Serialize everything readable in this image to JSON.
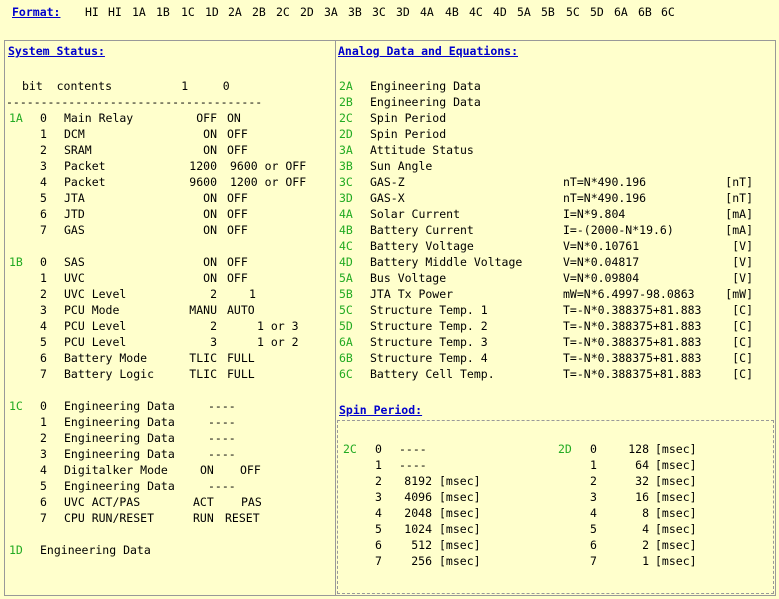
{
  "format": {
    "label": "Format:",
    "items": [
      "HI",
      "HI",
      "1A",
      "1B",
      "1C",
      "1D",
      "2A",
      "2B",
      "2C",
      "2D",
      "3A",
      "3B",
      "3C",
      "3D",
      "4A",
      "4B",
      "4C",
      "4D",
      "5A",
      "5B",
      "5C",
      "5D",
      "6A",
      "6B",
      "6C"
    ]
  },
  "system_status": {
    "title": "System Status:",
    "header": "bit  contents          1     0",
    "rule": "-------------------------------------",
    "rows": [
      {
        "byte": "1A",
        "bit": "0",
        "name": "Main Relay",
        "c1": "OFF",
        "c0": "ON"
      },
      {
        "byte": "",
        "bit": "1",
        "name": "DCM",
        "c1": "ON",
        "c0": "OFF"
      },
      {
        "byte": "",
        "bit": "2",
        "name": "SRAM",
        "c1": "ON",
        "c0": "OFF"
      },
      {
        "byte": "",
        "bit": "3",
        "name": "Packet",
        "c1": "1200",
        "c0": "9600 or OFF"
      },
      {
        "byte": "",
        "bit": "4",
        "name": "Packet",
        "c1": "9600",
        "c0": "1200 or OFF"
      },
      {
        "byte": "",
        "bit": "5",
        "name": "JTA",
        "c1": "ON",
        "c0": "OFF"
      },
      {
        "byte": "",
        "bit": "6",
        "name": "JTD",
        "c1": "ON",
        "c0": "OFF"
      },
      {
        "byte": "",
        "bit": "7",
        "name": "GAS",
        "c1": "ON",
        "c0": "OFF"
      },
      {
        "byte": "1B",
        "bit": "0",
        "name": "SAS",
        "c1": "ON",
        "c0": "OFF"
      },
      {
        "byte": "",
        "bit": "1",
        "name": "UVC",
        "c1": "ON",
        "c0": "OFF"
      },
      {
        "byte": "",
        "bit": "2",
        "name": "UVC Level",
        "c1": "2",
        "c0": "1"
      },
      {
        "byte": "",
        "bit": "3",
        "name": "PCU Mode",
        "c1": "MANU",
        "c0": "AUTO"
      },
      {
        "byte": "",
        "bit": "4",
        "name": "PCU Level",
        "c1": "2",
        "c0": "1 or 3"
      },
      {
        "byte": "",
        "bit": "5",
        "name": "PCU Level",
        "c1": "3",
        "c0": "1 or 2"
      },
      {
        "byte": "",
        "bit": "6",
        "name": "Battery Mode",
        "c1": "TLIC",
        "c0": "FULL"
      },
      {
        "byte": "",
        "bit": "7",
        "name": "Battery Logic",
        "c1": "TLIC",
        "c0": "FULL"
      },
      {
        "byte": "1C",
        "bit": "0",
        "name": "Engineering Data",
        "c1": "----",
        "c0": ""
      },
      {
        "byte": "",
        "bit": "1",
        "name": "Engineering Data",
        "c1": "----",
        "c0": ""
      },
      {
        "byte": "",
        "bit": "2",
        "name": "Engineering Data",
        "c1": "----",
        "c0": ""
      },
      {
        "byte": "",
        "bit": "3",
        "name": "Engineering Data",
        "c1": "----",
        "c0": ""
      },
      {
        "byte": "",
        "bit": "4",
        "name": "Digitalker Mode",
        "c1": "ON",
        "c0": "OFF"
      },
      {
        "byte": "",
        "bit": "5",
        "name": "Engineering Data",
        "c1": "----",
        "c0": ""
      },
      {
        "byte": "",
        "bit": "6",
        "name": "UVC ACT/PAS",
        "c1": "ACT",
        "c0": "PAS"
      },
      {
        "byte": "",
        "bit": "7",
        "name": "CPU RUN/RESET",
        "c1": "RUN",
        "c0": "RESET"
      }
    ],
    "row_1d": {
      "byte": "1D",
      "name": "Engineering Data"
    }
  },
  "analog": {
    "title": "Analog Data and Equations:",
    "rows": [
      {
        "id": "2A",
        "name": "Engineering Data",
        "eq": "",
        "unit": ""
      },
      {
        "id": "2B",
        "name": "Engineering Data",
        "eq": "",
        "unit": ""
      },
      {
        "id": "2C",
        "name": "Spin Period",
        "eq": "",
        "unit": ""
      },
      {
        "id": "2D",
        "name": "Spin Period",
        "eq": "",
        "unit": ""
      },
      {
        "id": "3A",
        "name": "Attitude Status",
        "eq": "",
        "unit": ""
      },
      {
        "id": "3B",
        "name": "Sun Angle",
        "eq": "",
        "unit": ""
      },
      {
        "id": "3C",
        "name": "GAS-Z",
        "eq": "nT=N*490.196",
        "unit": "[nT]"
      },
      {
        "id": "3D",
        "name": "GAS-X",
        "eq": "nT=N*490.196",
        "unit": "[nT]"
      },
      {
        "id": "4A",
        "name": "Solar Current",
        "eq": "I=N*9.804",
        "unit": "[mA]"
      },
      {
        "id": "4B",
        "name": "Battery Current",
        "eq": "I=-(2000-N*19.6)",
        "unit": "[mA]"
      },
      {
        "id": "4C",
        "name": "Battery Voltage",
        "eq": "V=N*0.10761",
        "unit": "[V]"
      },
      {
        "id": "4D",
        "name": "Battery Middle Voltage",
        "eq": "V=N*0.04817",
        "unit": "[V]"
      },
      {
        "id": "5A",
        "name": "Bus Voltage",
        "eq": "V=N*0.09804",
        "unit": "[V]"
      },
      {
        "id": "5B",
        "name": "JTA Tx Power",
        "eq": "mW=N*6.4997-98.0863",
        "unit": "[mW]"
      },
      {
        "id": "5C",
        "name": "Structure Temp. 1",
        "eq": "T=-N*0.388375+81.883",
        "unit": "[C]"
      },
      {
        "id": "5D",
        "name": "Structure Temp. 2",
        "eq": "T=-N*0.388375+81.883",
        "unit": "[C]"
      },
      {
        "id": "6A",
        "name": "Structure Temp. 3",
        "eq": "T=-N*0.388375+81.883",
        "unit": "[C]"
      },
      {
        "id": "6B",
        "name": "Structure Temp. 4",
        "eq": "T=-N*0.388375+81.883",
        "unit": "[C]"
      },
      {
        "id": "6C",
        "name": "Battery Cell Temp.",
        "eq": "T=-N*0.388375+81.883",
        "unit": "[C]"
      }
    ]
  },
  "spin": {
    "title": "Spin Period:",
    "left": {
      "id": "2C",
      "rows": [
        {
          "bit": "0",
          "val": "----",
          "unit": ""
        },
        {
          "bit": "1",
          "val": "----",
          "unit": ""
        },
        {
          "bit": "2",
          "val": "8192",
          "unit": "[msec]"
        },
        {
          "bit": "3",
          "val": "4096",
          "unit": "[msec]"
        },
        {
          "bit": "4",
          "val": "2048",
          "unit": "[msec]"
        },
        {
          "bit": "5",
          "val": "1024",
          "unit": "[msec]"
        },
        {
          "bit": "6",
          "val": "512",
          "unit": "[msec]"
        },
        {
          "bit": "7",
          "val": "256",
          "unit": "[msec]"
        }
      ]
    },
    "right": {
      "id": "2D",
      "rows": [
        {
          "bit": "0",
          "val": "128",
          "unit": "[msec]"
        },
        {
          "bit": "1",
          "val": "64",
          "unit": "[msec]"
        },
        {
          "bit": "2",
          "val": "32",
          "unit": "[msec]"
        },
        {
          "bit": "3",
          "val": "16",
          "unit": "[msec]"
        },
        {
          "bit": "4",
          "val": "8",
          "unit": "[msec]"
        },
        {
          "bit": "5",
          "val": "4",
          "unit": "[msec]"
        },
        {
          "bit": "6",
          "val": "2",
          "unit": "[msec]"
        },
        {
          "bit": "7",
          "val": "1",
          "unit": "[msec]"
        }
      ]
    }
  }
}
